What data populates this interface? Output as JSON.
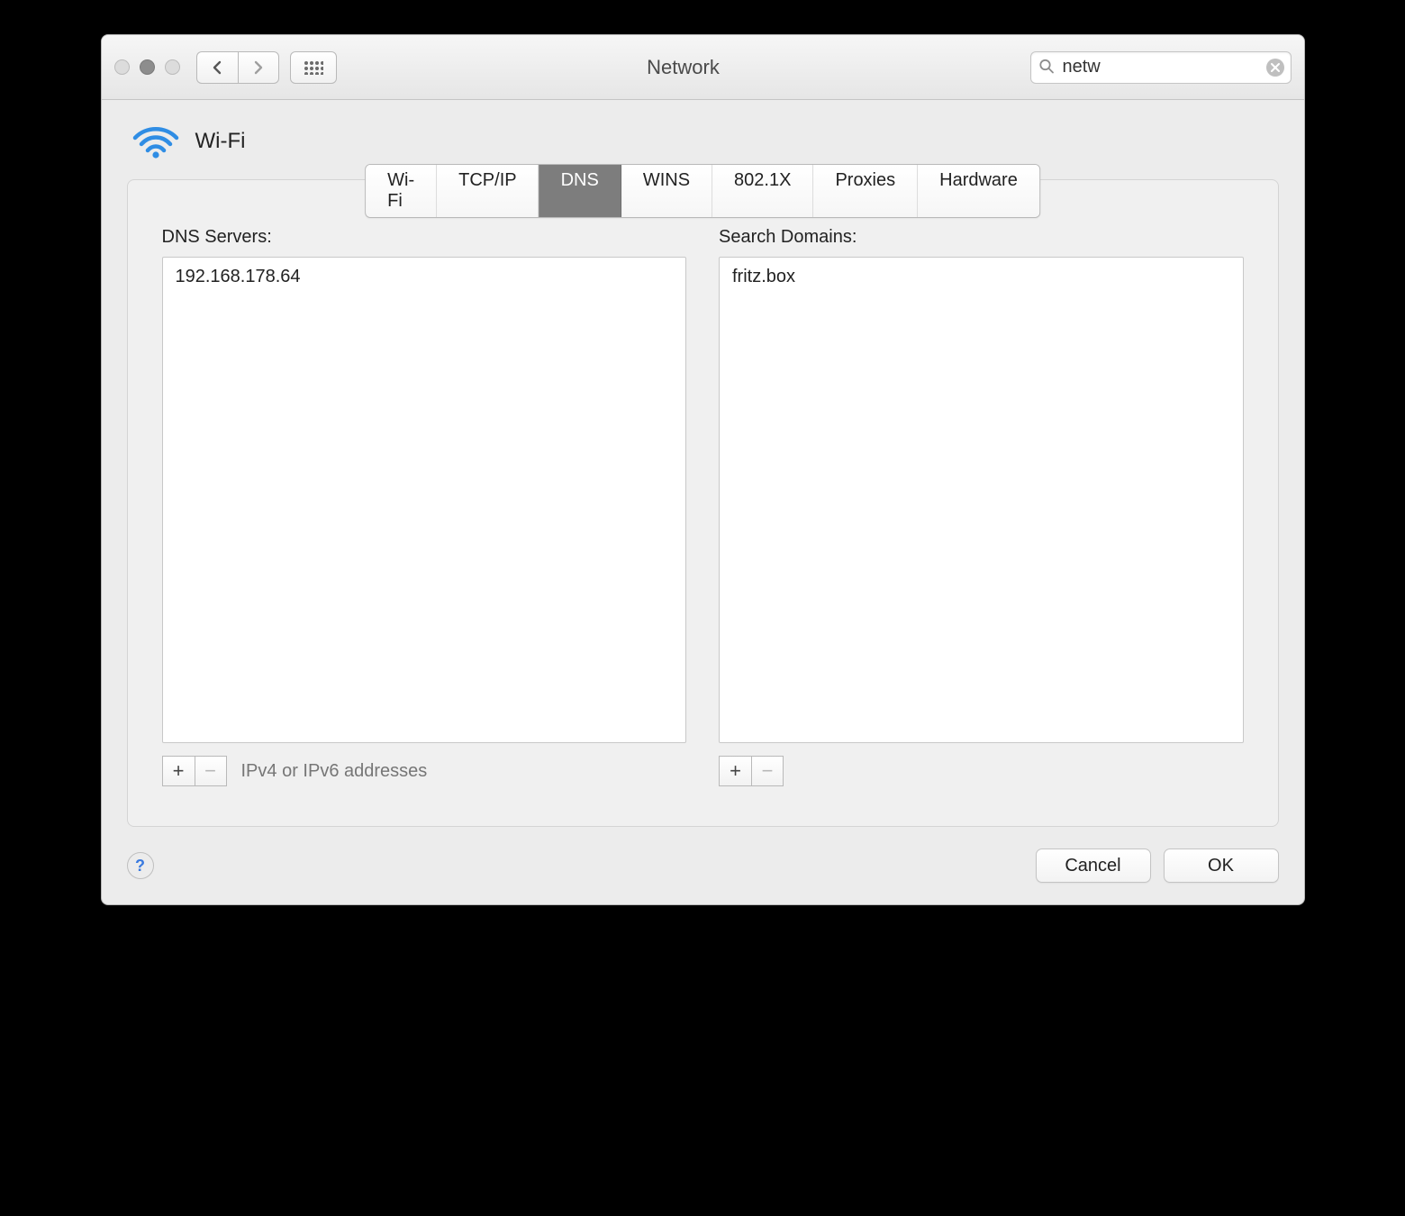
{
  "window": {
    "title": "Network"
  },
  "search": {
    "value": "netw"
  },
  "service": {
    "name": "Wi-Fi"
  },
  "tabs": [
    "Wi-Fi",
    "TCP/IP",
    "DNS",
    "WINS",
    "802.1X",
    "Proxies",
    "Hardware"
  ],
  "active_tab": "DNS",
  "dns": {
    "label": "DNS Servers:",
    "servers": [
      "192.168.178.64"
    ],
    "hint": "IPv4 or IPv6 addresses"
  },
  "search_domains": {
    "label": "Search Domains:",
    "domains": [
      "fritz.box"
    ]
  },
  "buttons": {
    "cancel": "Cancel",
    "ok": "OK"
  }
}
